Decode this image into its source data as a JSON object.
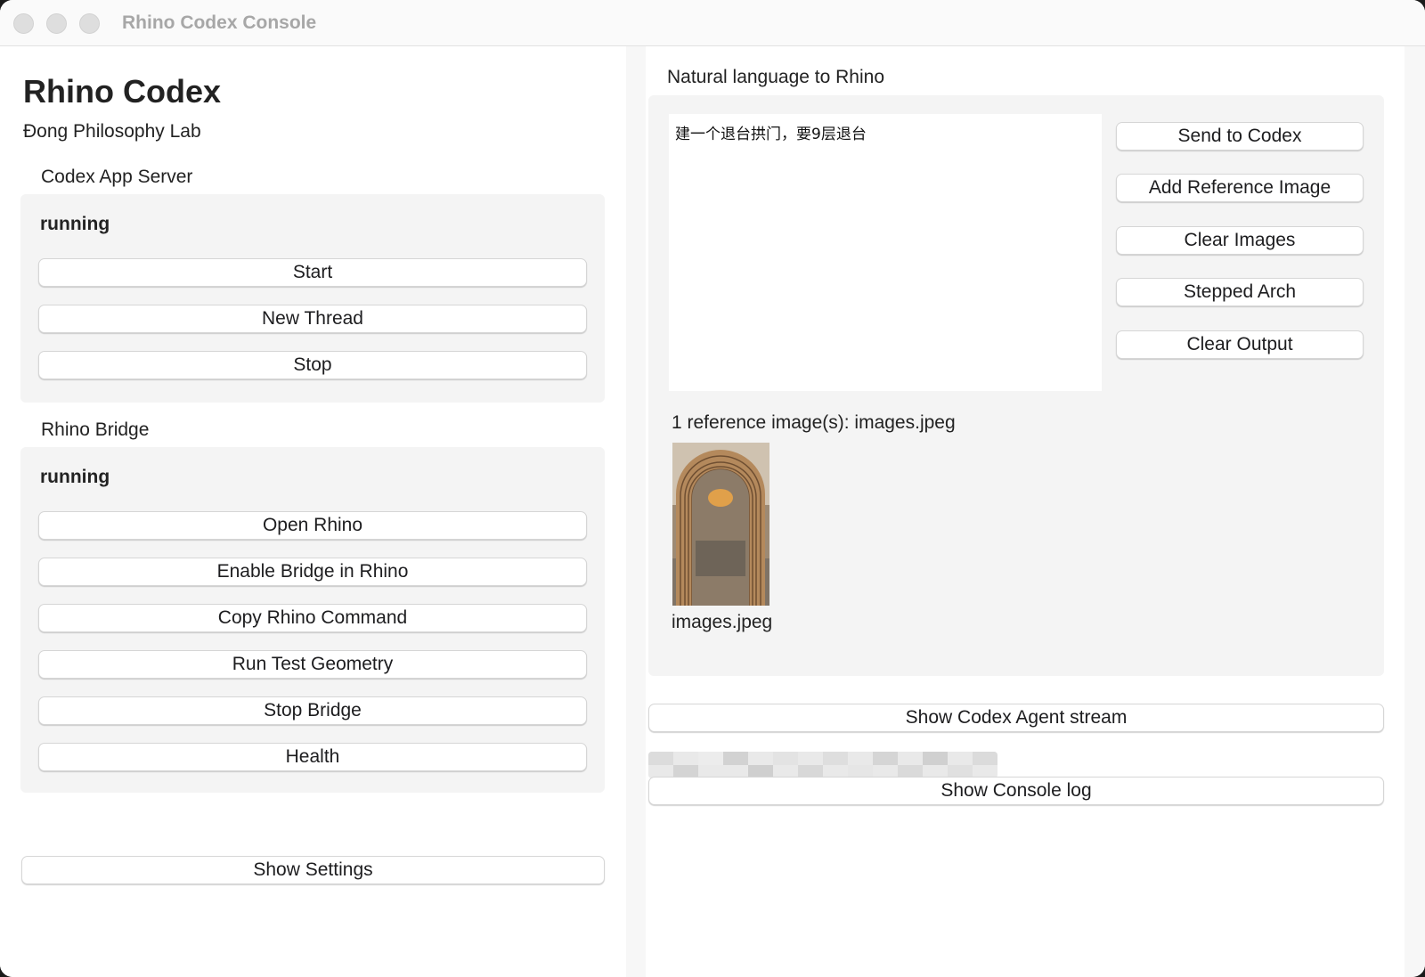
{
  "window": {
    "title": "Rhino Codex Console"
  },
  "sidebar": {
    "app_title": "Rhino Codex",
    "subtitle": "Đong Philosophy Lab",
    "codex_server": {
      "label": "Codex App Server",
      "status": "running",
      "buttons": [
        "Start",
        "New Thread",
        "Stop"
      ]
    },
    "rhino_bridge": {
      "label": "Rhino Bridge",
      "status": "running",
      "buttons": [
        "Open Rhino",
        "Enable Bridge in Rhino",
        "Copy Rhino Command",
        "Run Test Geometry",
        "Stop Bridge",
        "Health"
      ]
    },
    "settings_button": "Show Settings"
  },
  "main": {
    "nl_label": "Natural language to Rhino",
    "prompt_value": "建一个退台拱门，要9层退台",
    "buttons": [
      "Send to Codex",
      "Add Reference Image",
      "Clear Images",
      "Stepped Arch",
      "Clear Output"
    ],
    "reference_count": "1 reference image(s): images.jpeg",
    "thumbnail_name": "images.jpeg",
    "agent_stream_button": "Show Codex Agent stream",
    "console_log_button": "Show Console log"
  },
  "colors": {
    "panel": "#f4f4f4",
    "divider": "#f7f7f7",
    "button_border": "#d6d6d6",
    "arch": "#b4895c"
  }
}
